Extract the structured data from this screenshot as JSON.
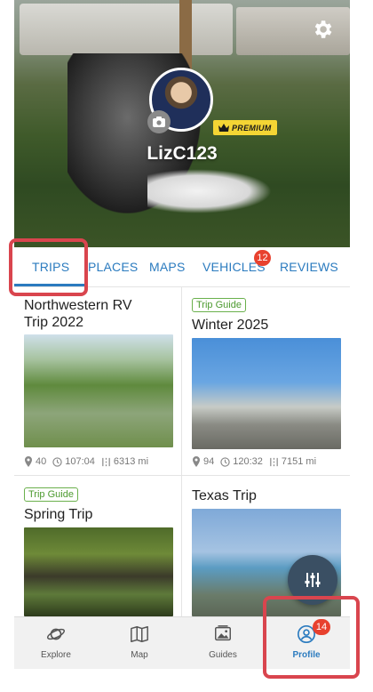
{
  "profile": {
    "username": "LizC123",
    "premium_label": "PREMIUM"
  },
  "tabs": [
    {
      "label": "TRIPS",
      "active": true
    },
    {
      "label": "PLACES"
    },
    {
      "label": "MAPS"
    },
    {
      "label": "VEHICLES",
      "badge": "12"
    },
    {
      "label": "REVIEWS"
    }
  ],
  "trips": [
    {
      "title": "Northwestern RV Trip 2022",
      "tag": "",
      "stops": "40",
      "duration": "107:04",
      "distance": "6313 mi"
    },
    {
      "title": "Winter 2025",
      "tag": "Trip Guide",
      "stops": "94",
      "duration": "120:32",
      "distance": "7151 mi"
    },
    {
      "title": "Spring Trip",
      "tag": "Trip Guide"
    },
    {
      "title": "Texas Trip",
      "tag": ""
    }
  ],
  "nav": [
    {
      "label": "Explore",
      "icon": "planet-icon"
    },
    {
      "label": "Map",
      "icon": "map-icon"
    },
    {
      "label": "Guides",
      "icon": "guides-icon"
    },
    {
      "label": "Profile",
      "icon": "profile-icon",
      "active": true,
      "badge": "14"
    }
  ],
  "colors": {
    "accent": "#2b7bbf",
    "badge": "#e8412e",
    "premium": "#f4d534",
    "trip_guide": "#6ab04c",
    "highlight": "#d9454e"
  }
}
